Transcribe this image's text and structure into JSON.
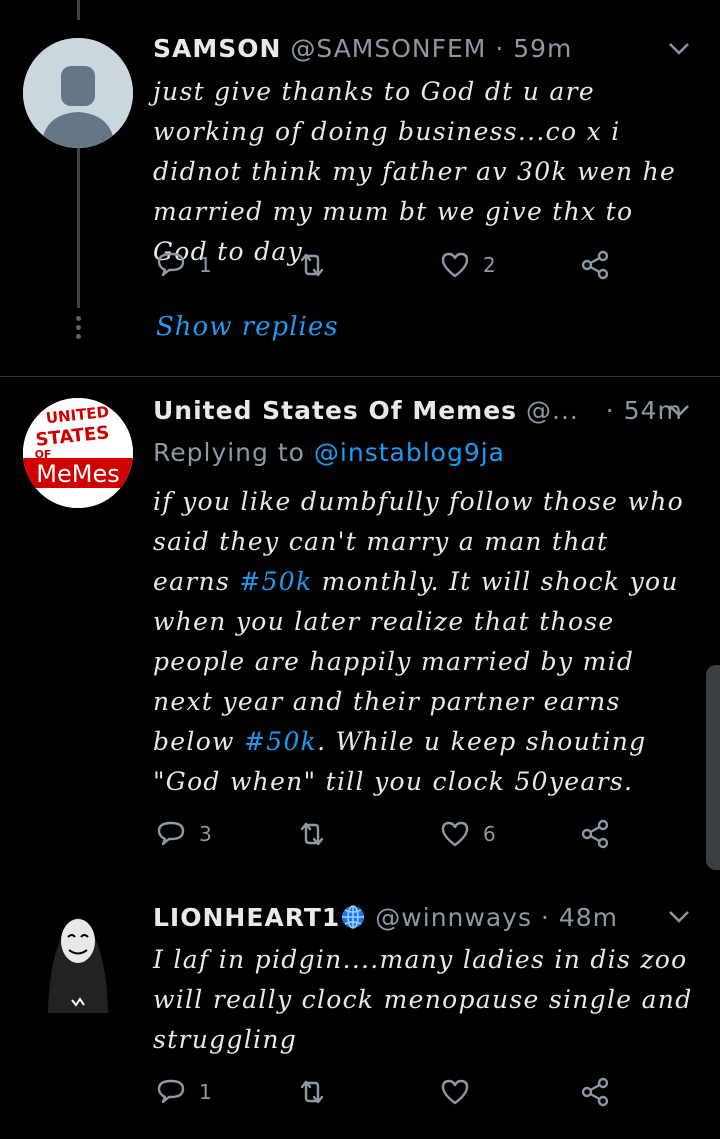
{
  "tweets": [
    {
      "display_name": "SAMSON",
      "handle": "@SAMSONFEM",
      "time": "59m",
      "text": "just give thanks to God dt u are working of doing business...co x i didnot think my father av 30k wen he married my mum bt we give thx to God to day",
      "replies": "1",
      "retweets": "",
      "likes": "2",
      "show_replies": "Show replies"
    },
    {
      "display_name": "United States Of Memes",
      "handle": "@...",
      "time": "54m",
      "replying_prefix": "Replying to",
      "replying_handle": "@instablog9ja",
      "text_parts": [
        "if you like dumbfully follow those who said they can't marry a man that earns ",
        "#50k",
        " monthly. It will shock you when you later realize that those people are happily married by mid next year and their partner earns below ",
        "#50k",
        ". While u keep shouting \"God when\" till you clock 50years."
      ],
      "replies": "3",
      "retweets": "",
      "likes": "6",
      "avatar_text": [
        "UNITED",
        "STATES",
        "OF",
        "MeMes"
      ]
    },
    {
      "display_name": "LIONHEART1",
      "handle": "@winnways",
      "time": "48m",
      "text": "I laf in pidgin....many ladies in dis zoo will really clock menopause single and struggling",
      "replies": "1",
      "retweets": "",
      "likes": ""
    }
  ],
  "colors": {
    "background": "#000000",
    "link": "#1d9bf0",
    "muted": "#8b98a5",
    "divider": "#2f3336"
  }
}
